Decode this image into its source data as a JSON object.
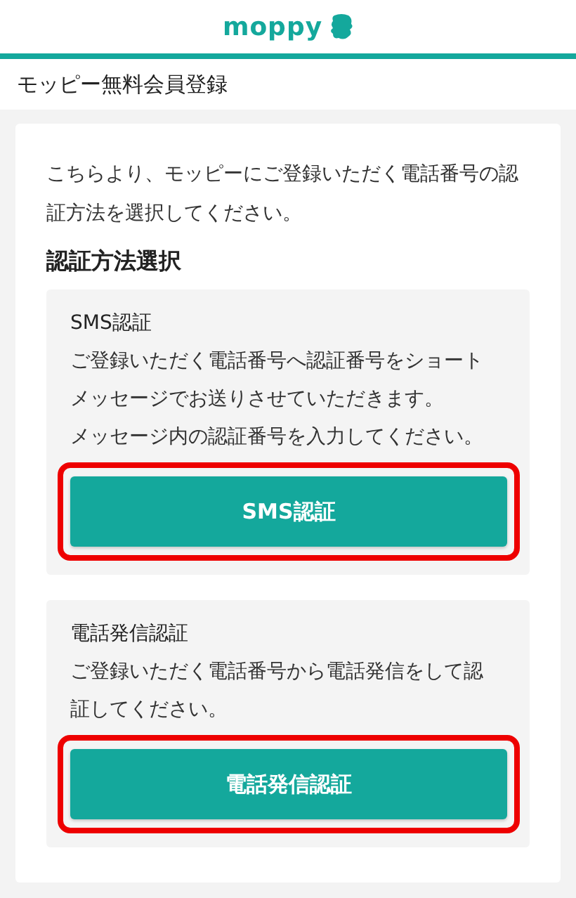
{
  "header": {
    "logo": "moppy"
  },
  "page_title": "モッピー無料会員登録",
  "intro": "こちらより、モッピーにご登録いただく電話番号の認証方法を選択してください。",
  "section_heading": "認証方法選択",
  "options": [
    {
      "title": "SMS認証",
      "description": [
        "ご登録いただく電話番号へ認証番号をショートメッセージでお送りさせていただきます。",
        "メッセージ内の認証番号を入力してください。"
      ],
      "button": "SMS認証",
      "highlighted": true
    },
    {
      "title": "電話発信認証",
      "description": [
        "ご登録いただく電話番号から電話発信をして認証してください。"
      ],
      "button": "電話発信認証",
      "highlighted": true
    }
  ]
}
